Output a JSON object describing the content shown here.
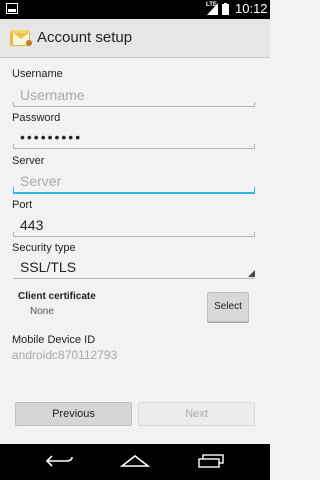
{
  "status_bar": {
    "network": "LTE",
    "time": "10:12"
  },
  "header": {
    "title": "Account setup",
    "icon": "email-app-icon"
  },
  "form": {
    "username": {
      "label": "Username",
      "placeholder": "Username",
      "value": ""
    },
    "password": {
      "label": "Password",
      "value": "•••••••••"
    },
    "server": {
      "label": "Server",
      "placeholder": "Server",
      "value": ""
    },
    "port": {
      "label": "Port",
      "value": "443"
    },
    "security_type": {
      "label": "Security type",
      "value": "SSL/TLS"
    },
    "client_certificate": {
      "label": "Client certificate",
      "value": "None",
      "button": "Select"
    },
    "mobile_device_id": {
      "label": "Mobile Device ID",
      "value": "androidc870112793"
    }
  },
  "footer": {
    "previous_label": "Previous",
    "next_label": "Next"
  },
  "colors": {
    "accent": "#33b5e5",
    "hint_text": "#a8a8a8"
  }
}
